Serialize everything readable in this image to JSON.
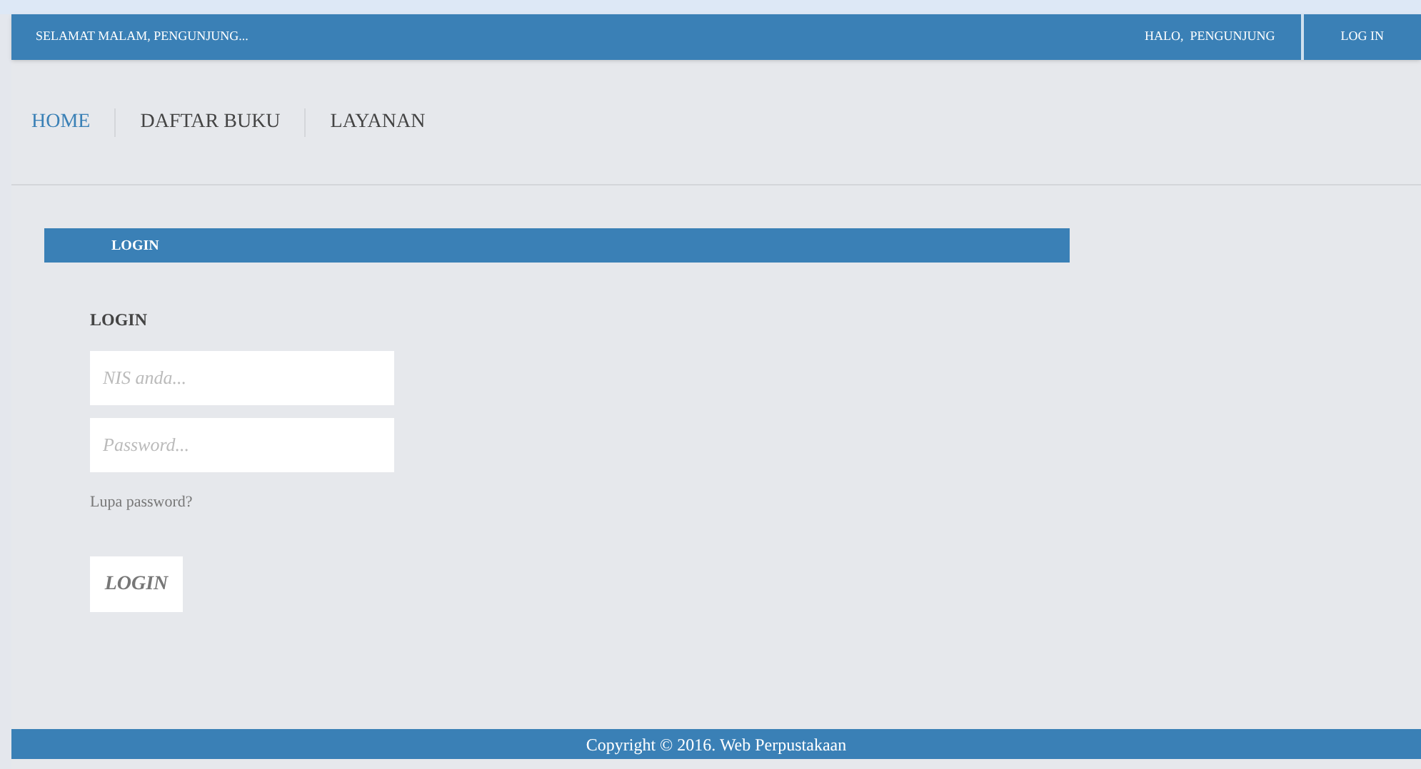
{
  "top_bar": {
    "greeting": "SELAMAT MALAM, PENGUNJUNG...",
    "user": "HALO,  PENGUNJUNG",
    "login_link": "LOG IN"
  },
  "nav": [
    {
      "label": "HOME",
      "selected": true
    },
    {
      "label": "DAFTAR BUKU",
      "selected": false
    },
    {
      "label": "LAYANAN",
      "selected": false
    }
  ],
  "section_title": "LOGIN",
  "form": {
    "heading": "LOGIN",
    "fields": [
      {
        "placeholder": "NIS anda..."
      },
      {
        "placeholder": "Password..."
      }
    ],
    "forgot_link": "Lupa password?",
    "button": "LOGIN"
  },
  "footer": "Copyright © 2016. Web Perpustakaan"
}
